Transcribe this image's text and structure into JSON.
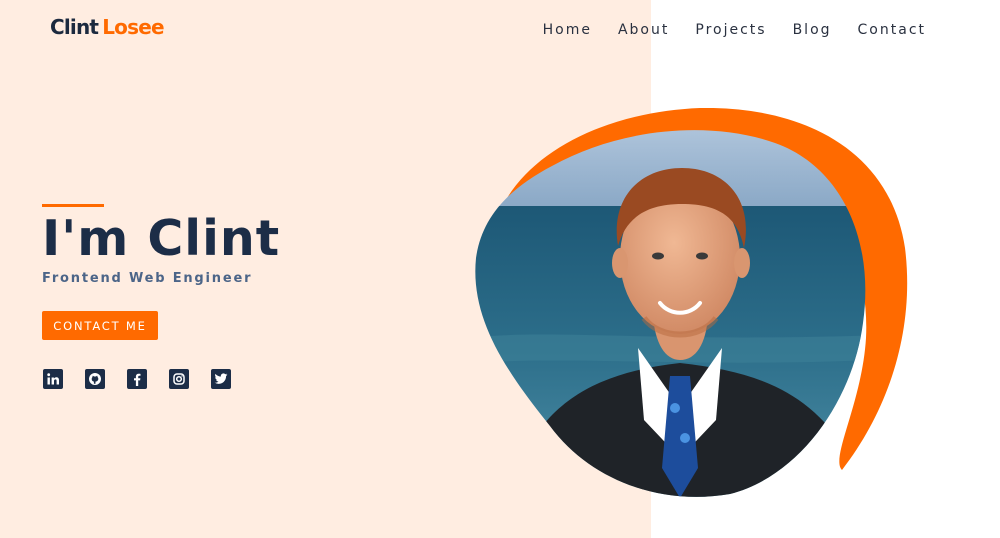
{
  "brand": {
    "first": "Clint",
    "last": "Losee"
  },
  "nav": [
    "Home",
    "About",
    "Projects",
    "Blog",
    "Contact"
  ],
  "hero": {
    "title": "I'm Clint",
    "subtitle": "Frontend Web Engineer",
    "cta_label": "CONTACT ME"
  },
  "socials": [
    "linkedin-icon",
    "github-icon",
    "facebook-icon",
    "instagram-icon",
    "twitter-icon"
  ],
  "colors": {
    "accent": "#ff6a00",
    "navy": "#1c2d47",
    "subtitle": "#4c6588",
    "left_bg": "#ffede1"
  }
}
